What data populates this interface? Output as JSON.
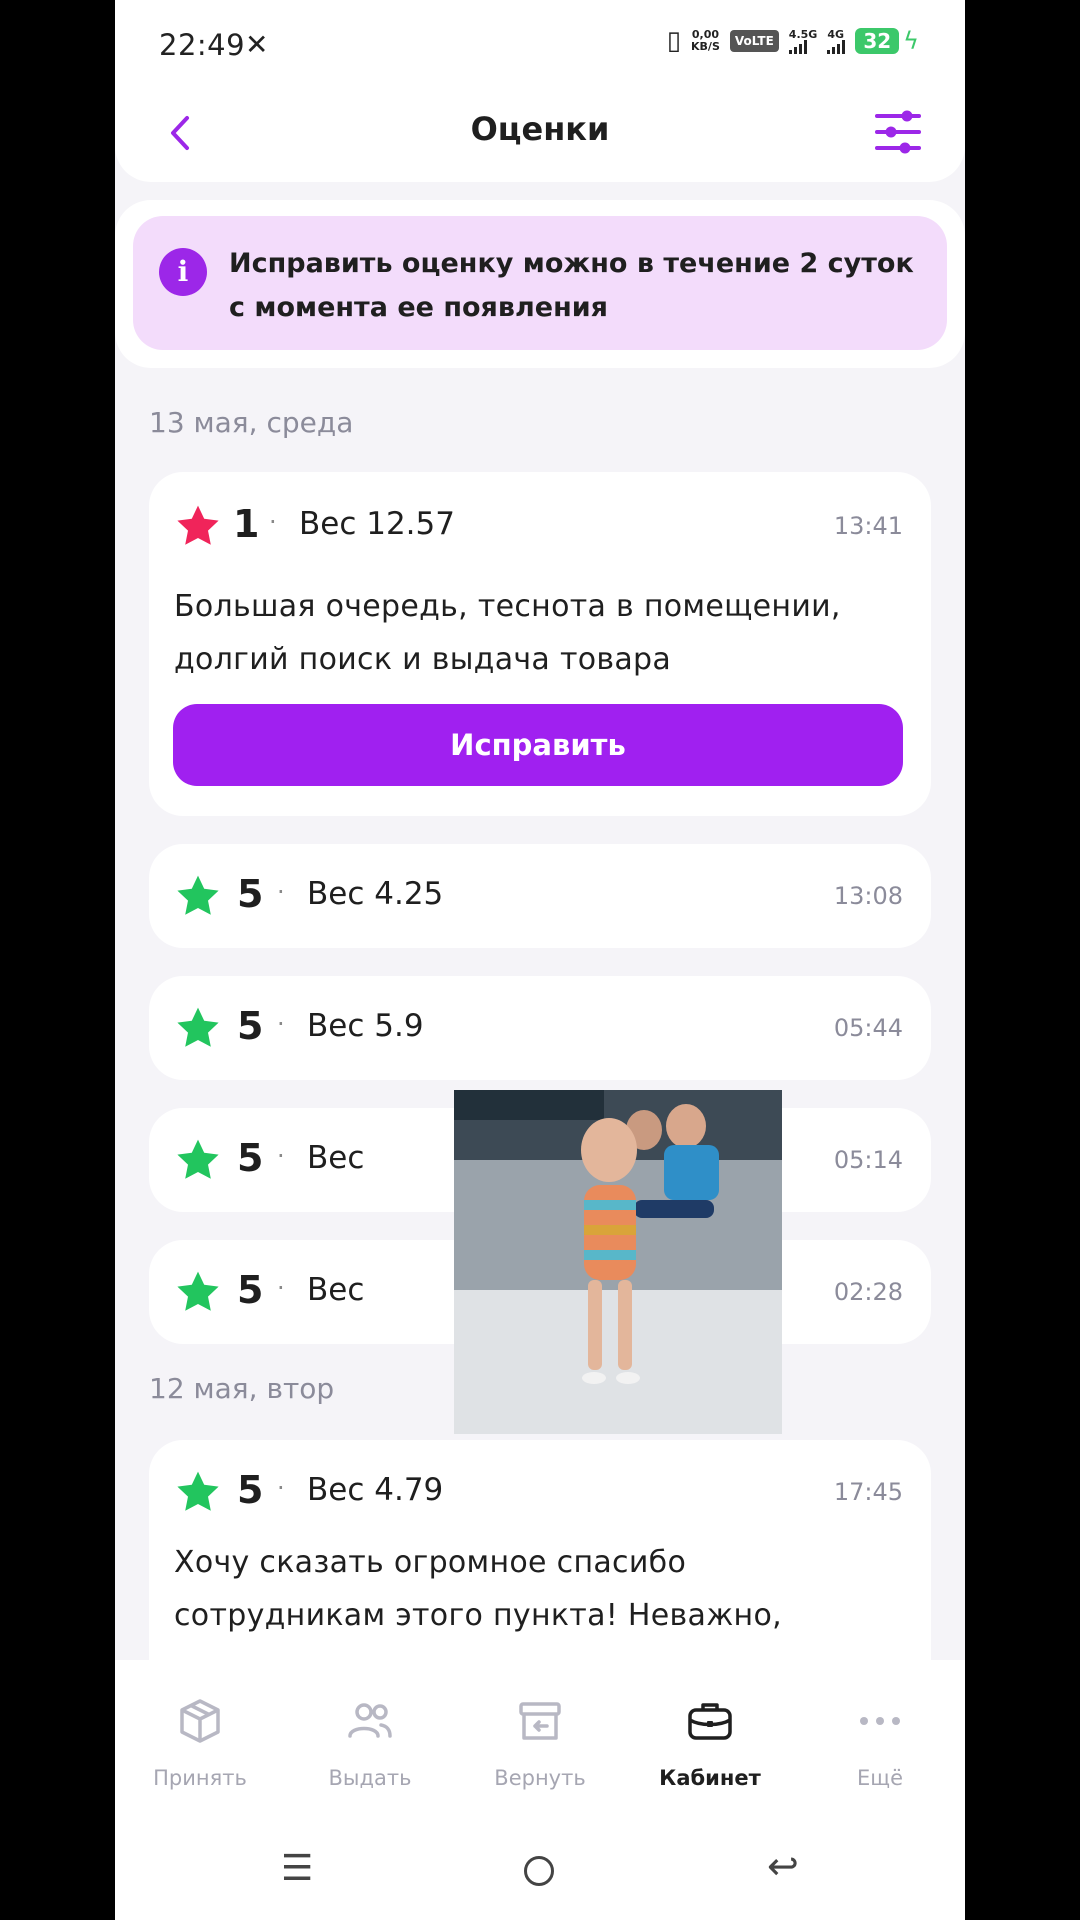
{
  "status": {
    "time": "22:49",
    "speed_value": "0,00",
    "speed_unit": "KB/S",
    "volte": "VoLTE",
    "net1": "4.5G",
    "net2": "4G",
    "battery": "32"
  },
  "header": {
    "title": "Оценки"
  },
  "banner": {
    "text": "Исправить оценку можно в течение 2 суток с момента ее появления"
  },
  "groups": [
    {
      "date": "13 мая, среда",
      "ratings": [
        {
          "score": "1",
          "weight": "Вес 12.57",
          "time": "13:41",
          "star_color": "#f0245a",
          "comment": "Большая очередь, теснота в помещении, долгий поиск и выдача товара",
          "button": "Исправить"
        },
        {
          "score": "5",
          "weight": "Вес 4.25",
          "time": "13:08",
          "star_color": "#22c55e"
        },
        {
          "score": "5",
          "weight": "Вес 5.9",
          "time": "05:44",
          "star_color": "#22c55e"
        },
        {
          "score": "5",
          "weight": "Вес",
          "time": "05:14",
          "star_color": "#22c55e"
        },
        {
          "score": "5",
          "weight": "Вес",
          "time": "02:28",
          "star_color": "#22c55e"
        }
      ]
    },
    {
      "date": "12 мая, втор",
      "ratings": [
        {
          "score": "5",
          "weight": "Вес 4.79",
          "time": "17:45",
          "star_color": "#22c55e",
          "comment": "Хочу сказать огромное спасибо сотрудникам этого пункта! Неважно,"
        }
      ]
    }
  ],
  "nav": [
    {
      "label": "Принять",
      "icon": "box-icon",
      "active": false
    },
    {
      "label": "Выдать",
      "icon": "users-icon",
      "active": false
    },
    {
      "label": "Вернуть",
      "icon": "return-box-icon",
      "active": false
    },
    {
      "label": "Кабинет",
      "icon": "briefcase-icon",
      "active": true
    },
    {
      "label": "Ещё",
      "icon": "more-dots-icon",
      "active": false
    }
  ],
  "colors": {
    "accent": "#a020f0",
    "banner_bg": "#f3dcfb",
    "star_low": "#f0245a",
    "star_high": "#22c55e"
  }
}
